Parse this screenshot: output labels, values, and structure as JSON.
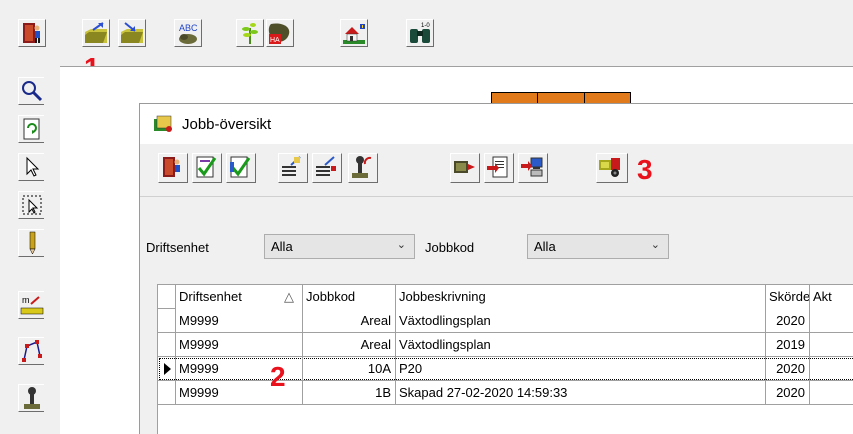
{
  "main_toolbar": {
    "buttons": [
      {
        "icon": "exit-door-icon"
      },
      {
        "icon": "open-folder-icon"
      },
      {
        "icon": "folder-import-icon"
      },
      {
        "icon": "abc-spellcheck-icon"
      },
      {
        "icon": "crop-plant-icon"
      },
      {
        "icon": "field-ha-icon"
      },
      {
        "icon": "farm-house-icon"
      },
      {
        "icon": "binoculars-icon"
      }
    ]
  },
  "left_toolbar": {
    "buttons": [
      {
        "icon": "magnifier-icon"
      },
      {
        "icon": "refresh-page-icon"
      },
      {
        "icon": "pointer-arrow-icon"
      },
      {
        "icon": "select-region-icon"
      },
      {
        "icon": "pencil-icon"
      },
      {
        "icon": "measure-ruler-icon"
      },
      {
        "icon": "polygon-draw-icon"
      },
      {
        "icon": "soil-sample-icon"
      }
    ],
    "measure_label": "m"
  },
  "annotations": {
    "one": "1",
    "two": "2",
    "three": "3"
  },
  "job_window": {
    "title": "Jobb-översikt",
    "toolbar_icons": [
      "exit-door-icon",
      "check-document-icon",
      "check-document-edit-icon",
      "list-edit-icon",
      "list-add-icon",
      "soil-sampler-icon",
      "truck-export-icon",
      "document-export-icon",
      "network-send-icon",
      "spreader-machine-icon"
    ],
    "filters": {
      "driftsenhet_label": "Driftsenhet",
      "driftsenhet_value": "Alla",
      "jobbkod_label": "Jobbkod",
      "jobbkod_value": "Alla"
    },
    "table": {
      "columns": [
        "Driftsenhet",
        "Jobbkod",
        "Jobbeskrivning",
        "Skördeå",
        "Akt"
      ],
      "sort_indicator": "△",
      "rows": [
        {
          "driftsenhet": "M9999",
          "jobbkod": "Areal",
          "beskrivning": "Växtodlingsplan",
          "skordear": "2020",
          "selected": false
        },
        {
          "driftsenhet": "M9999",
          "jobbkod": "Areal",
          "beskrivning": "Växtodlingsplan",
          "skordear": "2019",
          "selected": false
        },
        {
          "driftsenhet": "M9999",
          "jobbkod": "10A",
          "beskrivning": "P20",
          "skordear": "2020",
          "selected": true
        },
        {
          "driftsenhet": "M9999",
          "jobbkod": "1B",
          "beskrivning": "Skapad 27-02-2020 14:59:33",
          "skordear": "2020",
          "selected": false
        }
      ]
    }
  },
  "colors": {
    "annotation": "#e8111c",
    "window_bg": "#f0f0f0"
  }
}
